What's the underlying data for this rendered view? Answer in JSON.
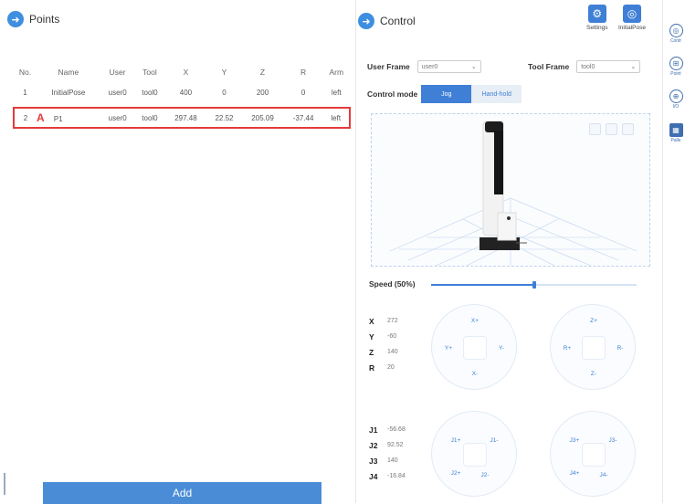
{
  "points_panel": {
    "title": "Points",
    "columns": [
      "No.",
      "Name",
      "User",
      "Tool",
      "X",
      "Y",
      "Z",
      "R",
      "Arm"
    ],
    "rows": [
      {
        "no": "1",
        "name": "InitialPose",
        "user": "user0",
        "tool": "tool0",
        "x": "400",
        "y": "0",
        "z": "200",
        "r": "0",
        "arm": "left"
      },
      {
        "no": "2",
        "marker": "A",
        "name": "P1",
        "user": "user0",
        "tool": "tool0",
        "x": "297.48",
        "y": "22.52",
        "z": "205.09",
        "r": "-37.44",
        "arm": "left"
      }
    ],
    "add_label": "Add"
  },
  "control_panel": {
    "title": "Control",
    "top_buttons": {
      "settings": "Settings",
      "initial_pose": "InitialPose"
    },
    "user_frame": {
      "label": "User Frame",
      "value": "user0"
    },
    "tool_frame": {
      "label": "Tool Frame",
      "value": "tool0"
    },
    "control_mode": {
      "label": "Control mode",
      "options": [
        "Jog",
        "Hand-hold"
      ],
      "selected": "Jog"
    },
    "speed": {
      "label": "Speed (50%)",
      "percent": 50
    },
    "cartesian": [
      {
        "axis": "X",
        "value": "272"
      },
      {
        "axis": "Y",
        "value": "-60"
      },
      {
        "axis": "Z",
        "value": "140"
      },
      {
        "axis": "R",
        "value": "20"
      }
    ],
    "joints": [
      {
        "axis": "J1",
        "value": "-56.68"
      },
      {
        "axis": "J2",
        "value": "92.52"
      },
      {
        "axis": "J3",
        "value": "140"
      },
      {
        "axis": "J4",
        "value": "-16.84"
      }
    ],
    "jog_xy": {
      "up": "X+",
      "down": "X-",
      "left": "Y+",
      "right": "Y-"
    },
    "jog_zr": {
      "up": "Z+",
      "down": "Z-",
      "left": "R+",
      "right": "R-"
    },
    "jog_j12": {
      "tl": "J1+",
      "tr": "J1-",
      "bl": "J2+",
      "br": "J2-"
    },
    "jog_j34": {
      "tl": "J3+",
      "tr": "J3-",
      "bl": "J4+",
      "br": "J4-"
    }
  },
  "sidebar": {
    "items": [
      {
        "label": "Contr",
        "icon": "control-icon"
      },
      {
        "label": "Point",
        "icon": "points-icon"
      },
      {
        "label": "I/O",
        "icon": "io-icon"
      },
      {
        "label": "Palle",
        "icon": "pallet-icon"
      }
    ]
  },
  "colors": {
    "accent": "#3f7fd6",
    "highlight": "#e53a3a"
  }
}
